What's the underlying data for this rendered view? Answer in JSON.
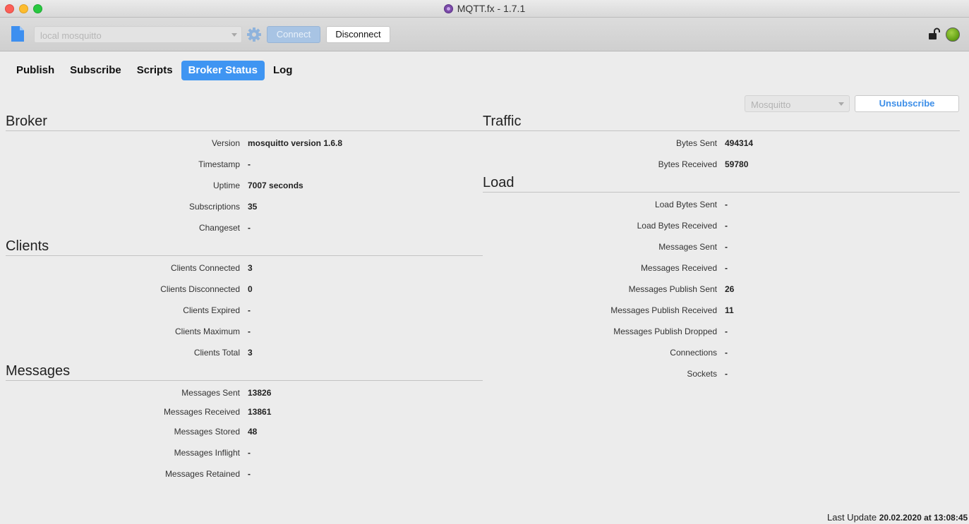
{
  "window": {
    "title": "MQTT.fx - 1.7.1"
  },
  "toolbar": {
    "profile": "local mosquitto",
    "connect_label": "Connect",
    "disconnect_label": "Disconnect"
  },
  "tabs": [
    "Publish",
    "Subscribe",
    "Scripts",
    "Broker Status",
    "Log"
  ],
  "active_tab": "Broker Status",
  "topic_select": "Mosquitto",
  "unsubscribe_label": "Unsubscribe",
  "broker": {
    "title": "Broker",
    "rows": [
      {
        "label": "Version",
        "value": "mosquitto version 1.6.8"
      },
      {
        "label": "Timestamp",
        "value": "-"
      },
      {
        "label": "Uptime",
        "value": "7007 seconds"
      },
      {
        "label": "Subscriptions",
        "value": "35"
      },
      {
        "label": "Changeset",
        "value": "-"
      }
    ]
  },
  "clients": {
    "title": "Clients",
    "rows": [
      {
        "label": "Clients Connected",
        "value": "3"
      },
      {
        "label": "Clients Disconnected",
        "value": "0"
      },
      {
        "label": "Clients Expired",
        "value": "-"
      },
      {
        "label": "Clients Maximum",
        "value": "-"
      },
      {
        "label": "Clients Total",
        "value": "3"
      }
    ]
  },
  "messages": {
    "title": "Messages",
    "rows": [
      {
        "label": "Messages Sent",
        "value": "13826"
      },
      {
        "label": "Messages Received",
        "value": "13861"
      },
      {
        "label": "Messages Stored",
        "value": "48"
      },
      {
        "label": "Messages Inflight",
        "value": "-"
      },
      {
        "label": "Messages Retained",
        "value": "-"
      }
    ]
  },
  "traffic": {
    "title": "Traffic",
    "rows": [
      {
        "label": "Bytes Sent",
        "value": "494314"
      },
      {
        "label": "Bytes Received",
        "value": "59780"
      }
    ]
  },
  "load": {
    "title": "Load",
    "rows": [
      {
        "label": "Load Bytes Sent",
        "value": "-"
      },
      {
        "label": "Load Bytes Received",
        "value": "-"
      },
      {
        "label": "Messages Sent",
        "value": "-"
      },
      {
        "label": "Messages Received",
        "value": "-"
      },
      {
        "label": "Messages Publish Sent",
        "value": "26"
      },
      {
        "label": "Messages Publish Received",
        "value": "11"
      },
      {
        "label": "Messages Publish Dropped",
        "value": "-"
      },
      {
        "label": "Connections",
        "value": "-"
      },
      {
        "label": "Sockets",
        "value": "-"
      }
    ]
  },
  "footer": {
    "label": "Last Update",
    "value": "20.02.2020 at 13:08:45"
  }
}
